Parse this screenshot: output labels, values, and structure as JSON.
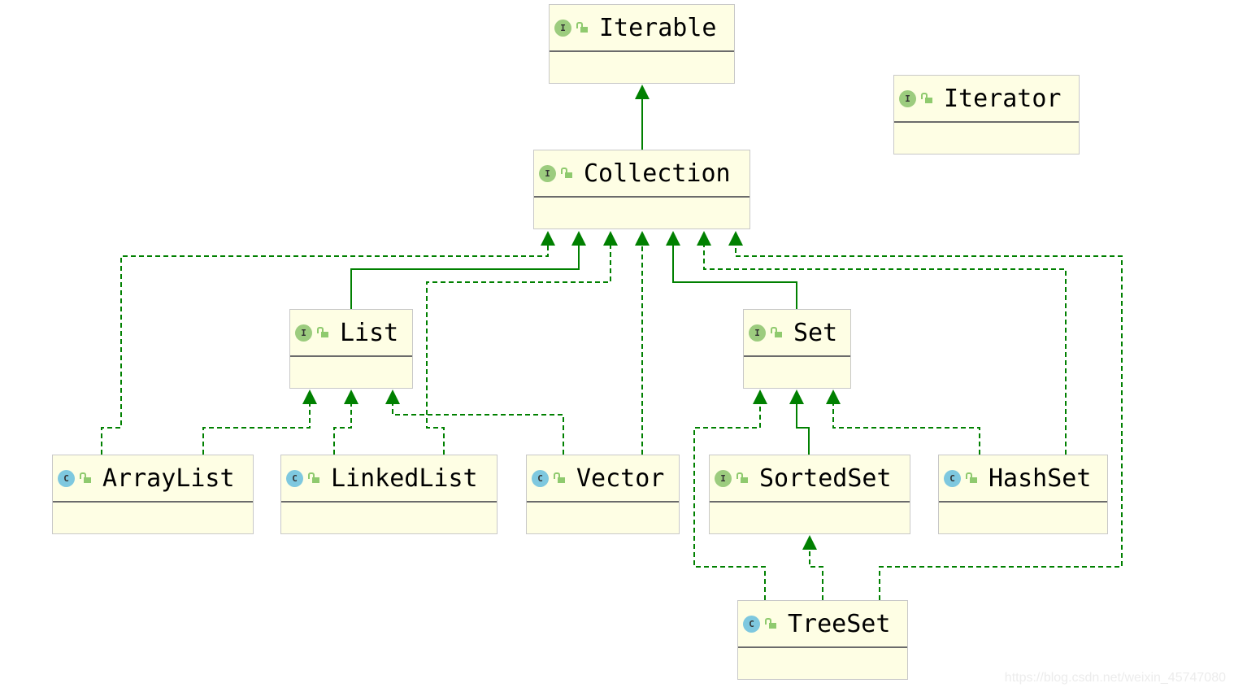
{
  "diagram": {
    "nodes": [
      {
        "id": "Iterable",
        "kind": "interface",
        "badge": "I"
      },
      {
        "id": "Iterator",
        "kind": "interface",
        "badge": "I"
      },
      {
        "id": "Collection",
        "kind": "interface",
        "badge": "I"
      },
      {
        "id": "List",
        "kind": "interface",
        "badge": "I"
      },
      {
        "id": "Set",
        "kind": "interface",
        "badge": "I"
      },
      {
        "id": "ArrayList",
        "kind": "class",
        "badge": "C"
      },
      {
        "id": "LinkedList",
        "kind": "class",
        "badge": "C"
      },
      {
        "id": "Vector",
        "kind": "class",
        "badge": "C"
      },
      {
        "id": "SortedSet",
        "kind": "interface",
        "badge": "I"
      },
      {
        "id": "HashSet",
        "kind": "class",
        "badge": "C"
      },
      {
        "id": "TreeSet",
        "kind": "class",
        "badge": "C"
      }
    ],
    "edges": [
      {
        "from": "Collection",
        "to": "Iterable",
        "type": "extends"
      },
      {
        "from": "ArrayList",
        "to": "Collection",
        "type": "implements"
      },
      {
        "from": "List",
        "to": "Collection",
        "type": "extends"
      },
      {
        "from": "LinkedList",
        "to": "Collection",
        "type": "implements"
      },
      {
        "from": "Vector",
        "to": "Collection",
        "type": "implements"
      },
      {
        "from": "Set",
        "to": "Collection",
        "type": "extends"
      },
      {
        "from": "HashSet",
        "to": "Collection",
        "type": "implements"
      },
      {
        "from": "TreeSet",
        "to": "Collection",
        "type": "implements"
      },
      {
        "from": "ArrayList",
        "to": "List",
        "type": "implements"
      },
      {
        "from": "LinkedList",
        "to": "List",
        "type": "implements"
      },
      {
        "from": "Vector",
        "to": "List",
        "type": "implements"
      },
      {
        "from": "TreeSet",
        "to": "Set",
        "type": "implements"
      },
      {
        "from": "SortedSet",
        "to": "Set",
        "type": "extends"
      },
      {
        "from": "HashSet",
        "to": "Set",
        "type": "implements"
      },
      {
        "from": "TreeSet",
        "to": "SortedSet",
        "type": "implements"
      }
    ],
    "colors": {
      "edge": "#008000",
      "box": "#fefee4",
      "interface_badge": "#9ccc7e",
      "class_badge": "#7ec8df"
    }
  },
  "watermark": "https://blog.csdn.net/weixin_45747080"
}
